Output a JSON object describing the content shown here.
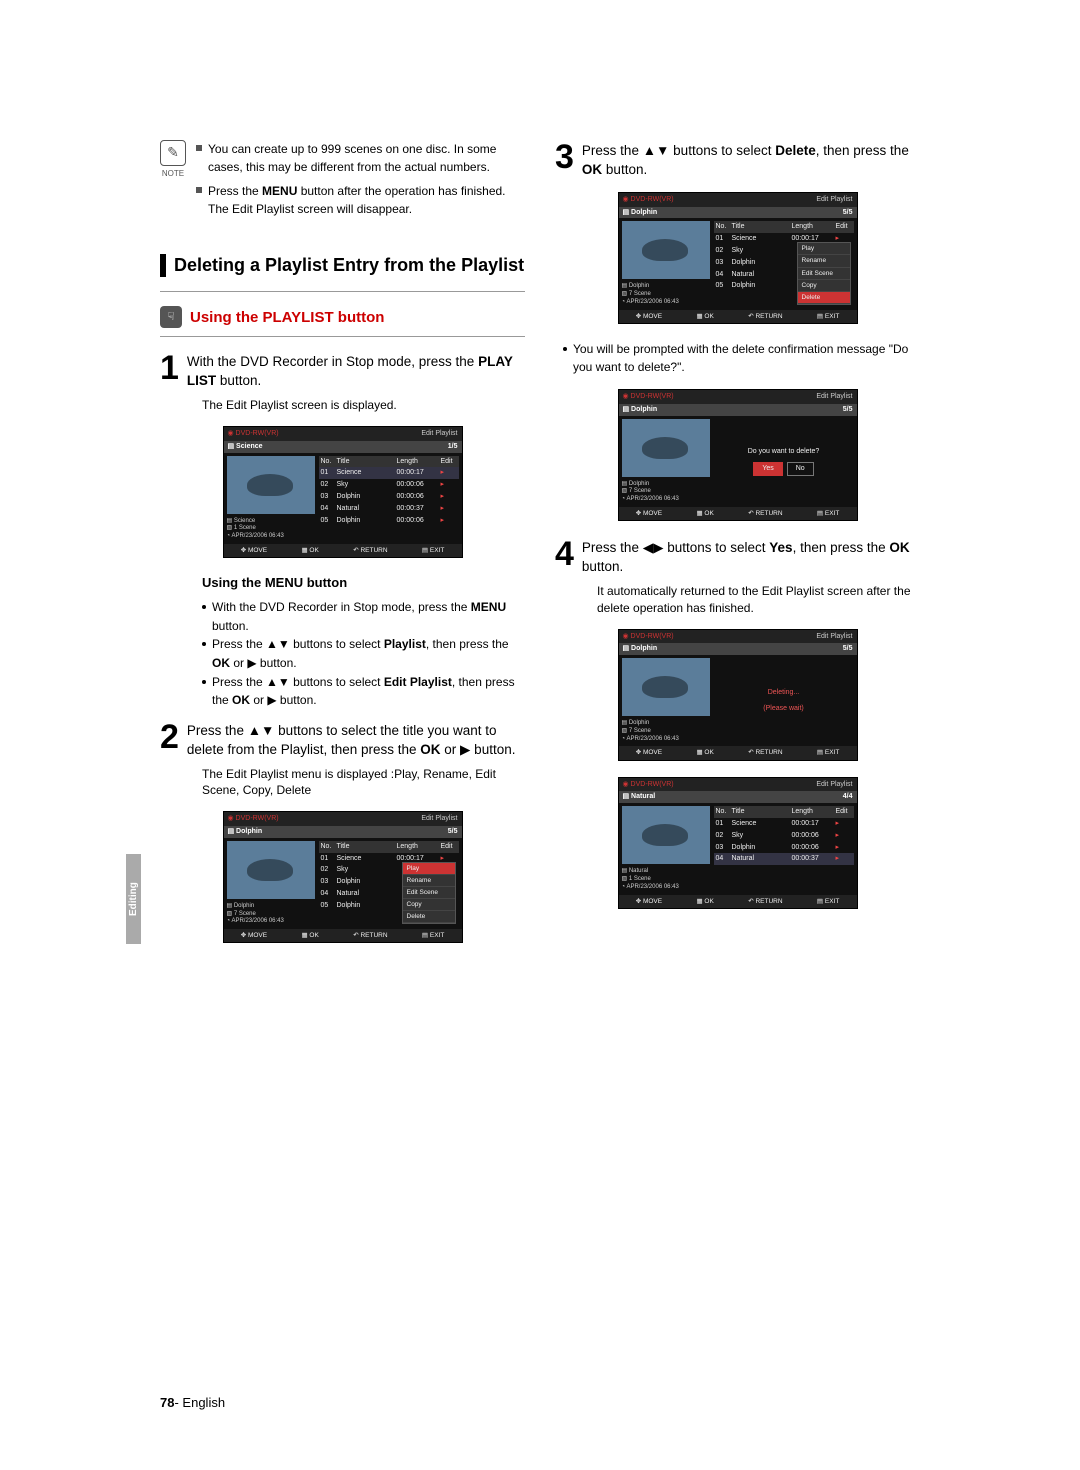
{
  "notes": {
    "label": "NOTE",
    "items": [
      "You can create up to 999 scenes on one disc. In some cases, this may be different from the actual numbers.",
      "Press the <b>MENU</b> button after the operation has finished. The Edit Playlist screen will disappear."
    ]
  },
  "section_title": "Deleting a Playlist Entry from the Playlist",
  "playlist_button_title": "Using the PLAYLIST button",
  "steps": {
    "s1": {
      "num": "1",
      "txt": "With the DVD Recorder in Stop mode, press the <b>PLAY LIST</b> button.",
      "sub": "The Edit Playlist screen is displayed."
    },
    "s2": {
      "num": "2",
      "txt": "Press the ▲▼ buttons to select the title you want to delete from the Playlist, then press the <b>OK</b> or ▶ button.",
      "sub": "The Edit Playlist menu is displayed :Play, Rename, Edit Scene, Copy, Delete"
    },
    "s3": {
      "num": "3",
      "txt": "Press the ▲▼ buttons to select <b>Delete</b>, then press the <b>OK</b> button."
    },
    "s4": {
      "num": "4",
      "txt": "Press the ◀▶ buttons to select <b>Yes</b>, then press the <b>OK</b> button.",
      "sub": "It automatically returned to the Edit Playlist screen after the delete operation has finished."
    }
  },
  "menu_section": {
    "heading": "Using the MENU button",
    "items": [
      "With the DVD Recorder in Stop mode, press the <b>MENU</b> button.",
      "Press the ▲▼ buttons to select <b>Playlist</b>, then press the <b>OK</b> or ▶ button.",
      "Press the ▲▼ buttons to select <b>Edit Playlist</b>, then press the <b>OK</b> or ▶ button."
    ]
  },
  "right_note": "You will be prompted with the delete confirmation message \"Do you want to delete?\".",
  "screens": {
    "disc": "DVD-RW(VR)",
    "ep_label": "Edit Playlist",
    "foot": {
      "move": "MOVE",
      "ok": "OK",
      "ret": "RETURN",
      "exit": "EXIT"
    },
    "meta_date": "APR/23/2006 06:43",
    "th": {
      "no": "No.",
      "title": "Title",
      "len": "Length",
      "edit": "Edit"
    },
    "scr1": {
      "bar": "Science",
      "cnt": "1/5",
      "m1": "Science",
      "m2": "1 Scene",
      "rows": [
        {
          "n": "01",
          "t": "Science",
          "l": "00:00:17",
          "sel": true
        },
        {
          "n": "02",
          "t": "Sky",
          "l": "00:00:06"
        },
        {
          "n": "03",
          "t": "Dolphin",
          "l": "00:00:06"
        },
        {
          "n": "04",
          "t": "Natural",
          "l": "00:00:37"
        },
        {
          "n": "05",
          "t": "Dolphin",
          "l": "00:00:06"
        }
      ]
    },
    "scr2": {
      "bar": "Dolphin",
      "cnt": "5/5",
      "m1": "Dolphin",
      "m2": "7 Scene",
      "rows": [
        {
          "n": "01",
          "t": "Science",
          "l": "00:00:17"
        },
        {
          "n": "02",
          "t": "Sky"
        },
        {
          "n": "03",
          "t": "Dolphin"
        },
        {
          "n": "04",
          "t": "Natural"
        },
        {
          "n": "05",
          "t": "Dolphin"
        }
      ],
      "menu": [
        "Play",
        "Rename",
        "Edit Scene",
        "Copy",
        "Delete"
      ],
      "menu_sel": 0
    },
    "scr3": {
      "bar": "Dolphin",
      "cnt": "5/5",
      "m1": "Dolphin",
      "m2": "7 Scene",
      "rows": [
        {
          "n": "01",
          "t": "Science",
          "l": "00:00:17"
        },
        {
          "n": "02",
          "t": "Sky"
        },
        {
          "n": "03",
          "t": "Dolphin"
        },
        {
          "n": "04",
          "t": "Natural"
        },
        {
          "n": "05",
          "t": "Dolphin"
        }
      ],
      "menu": [
        "Play",
        "Rename",
        "Edit Scene",
        "Copy",
        "Delete"
      ],
      "menu_sel": 4
    },
    "scr4": {
      "bar": "Dolphin",
      "cnt": "5/5",
      "m1": "Dolphin",
      "m2": "7 Scene",
      "msg": "Do you want to delete?",
      "yes": "Yes",
      "no": "No"
    },
    "scr5": {
      "bar": "Dolphin",
      "cnt": "5/5",
      "m1": "Dolphin",
      "m2": "7 Scene",
      "msg1": "Deleting...",
      "msg2": "(Please wait)"
    },
    "scr6": {
      "bar": "Natural",
      "cnt": "4/4",
      "m1": "Natural",
      "m2": "1 Scene",
      "rows": [
        {
          "n": "01",
          "t": "Science",
          "l": "00:00:17"
        },
        {
          "n": "02",
          "t": "Sky",
          "l": "00:00:06"
        },
        {
          "n": "03",
          "t": "Dolphin",
          "l": "00:00:06"
        },
        {
          "n": "04",
          "t": "Natural",
          "l": "00:00:37",
          "sel": true
        }
      ]
    }
  },
  "side_tab": "Editing",
  "footer": {
    "page": "78",
    "lang": "English",
    "sep": "- "
  }
}
